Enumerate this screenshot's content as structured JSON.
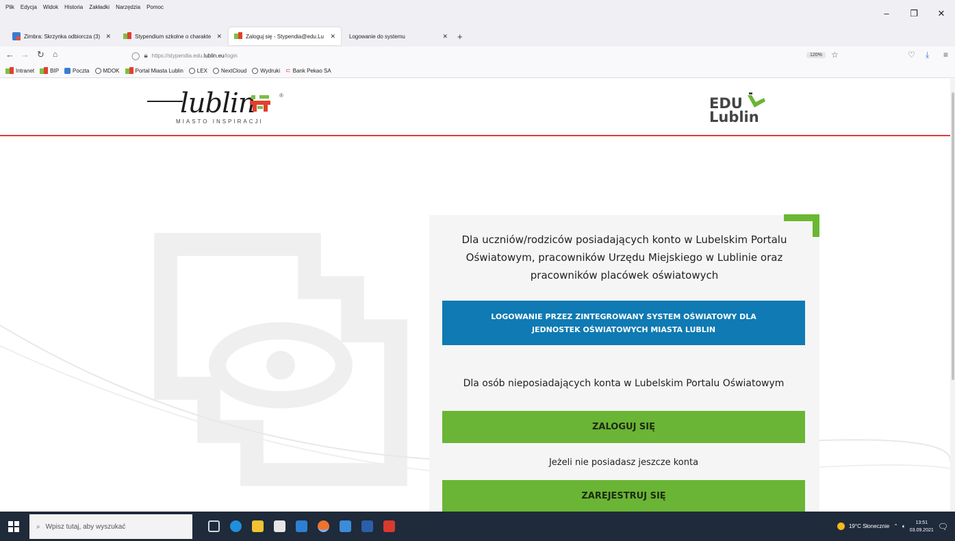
{
  "menubar": {
    "items": [
      "Plik",
      "Edycja",
      "Widok",
      "Historia",
      "Zakładki",
      "Narzędzia",
      "Pomoc"
    ]
  },
  "tabs": [
    {
      "label": "Zimbra: Skrzynka odbiorcza (3)",
      "icon": "zimbra-icon"
    },
    {
      "label": "Stypendium szkolne o charakte",
      "icon": "lublin-favicon"
    },
    {
      "label": "Zaloguj się - Stypendia@edu.Lu",
      "icon": "lublin-favicon",
      "active": true
    },
    {
      "label": "Logowanie do systemu",
      "icon": ""
    }
  ],
  "navbar": {
    "url_prefix": "https://stypendia.edu.",
    "url_domain": "lublin.eu",
    "url_path": "/login",
    "zoom": "120%"
  },
  "bookmarks": [
    {
      "label": "Intranet",
      "icon": "lublin-favicon"
    },
    {
      "label": "BIP",
      "icon": "lublin-favicon"
    },
    {
      "label": "Poczta",
      "icon": "zimbra-icon"
    },
    {
      "label": "MDOK",
      "icon": "globe-icon"
    },
    {
      "label": "Portal Miasta Lublin",
      "icon": "lublin-favicon"
    },
    {
      "label": "LEX",
      "icon": "globe-icon"
    },
    {
      "label": "NextCloud",
      "icon": "globe-icon"
    },
    {
      "label": "Wydruki",
      "icon": "globe-icon"
    },
    {
      "label": "Bank Pekao SA",
      "icon": "pekao-icon"
    }
  ],
  "header": {
    "logo_word": "lublin",
    "logo_subtitle": "MIASTO INSPIRACJI",
    "logo_reg": "®",
    "edu_top": "EDU",
    "edu_bottom": "Lublin"
  },
  "card": {
    "intro": "Dla uczniów/rodziców posiadających konto w Lubelskim Portalu Oświatowym, pracowników Urzędu Miejskiego w Lublinie oraz pracowników placówek oświatowych",
    "integrated_login": "LOGOWANIE PRZEZ ZINTEGROWANY SYSTEM OŚWIATOWY DLA JEDNOSTEK OŚWIATOWYCH MIASTA LUBLIN",
    "no_account_text": "Dla osób nieposiadających konta w Lubelskim Portalu Oświatowym",
    "login_label": "ZALOGUJ SIĘ",
    "register_prompt": "Jeżeli nie posiadasz jeszcze konta",
    "register_label": "ZAREJESTRUJ SIĘ"
  },
  "colors": {
    "accent_blue": "#0f7ab3",
    "accent_green": "#6ab535",
    "header_rule": "#e2383d"
  },
  "taskbar": {
    "search_placeholder": "Wpisz tutaj, aby wyszukać",
    "weather": "19°C Słonecznie",
    "time": "13:51",
    "date": "03.09.2021"
  }
}
